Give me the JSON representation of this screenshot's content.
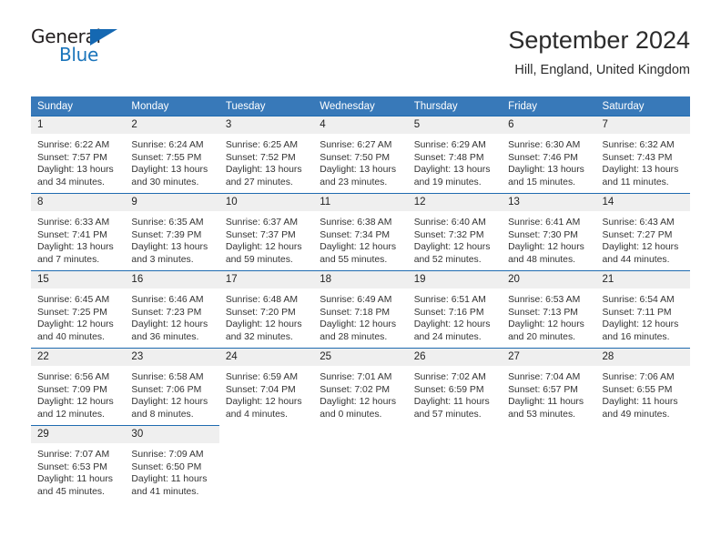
{
  "brand": {
    "name_part1": "General",
    "name_part2": "Blue",
    "triangle_color": "#1568b2",
    "blue_color": "#1b75bb"
  },
  "header": {
    "title": "September 2024",
    "subtitle": "Hill, England, United Kingdom"
  },
  "theme": {
    "header_row_bg": "#3879b9",
    "row_top_border": "#1f6bb0",
    "daynum_bg": "#efefef"
  },
  "weekday_headers": [
    "Sunday",
    "Monday",
    "Tuesday",
    "Wednesday",
    "Thursday",
    "Friday",
    "Saturday"
  ],
  "weeks": [
    [
      {
        "day": "1",
        "sunrise": "Sunrise: 6:22 AM",
        "sunset": "Sunset: 7:57 PM",
        "daylight1": "Daylight: 13 hours",
        "daylight2": "and 34 minutes."
      },
      {
        "day": "2",
        "sunrise": "Sunrise: 6:24 AM",
        "sunset": "Sunset: 7:55 PM",
        "daylight1": "Daylight: 13 hours",
        "daylight2": "and 30 minutes."
      },
      {
        "day": "3",
        "sunrise": "Sunrise: 6:25 AM",
        "sunset": "Sunset: 7:52 PM",
        "daylight1": "Daylight: 13 hours",
        "daylight2": "and 27 minutes."
      },
      {
        "day": "4",
        "sunrise": "Sunrise: 6:27 AM",
        "sunset": "Sunset: 7:50 PM",
        "daylight1": "Daylight: 13 hours",
        "daylight2": "and 23 minutes."
      },
      {
        "day": "5",
        "sunrise": "Sunrise: 6:29 AM",
        "sunset": "Sunset: 7:48 PM",
        "daylight1": "Daylight: 13 hours",
        "daylight2": "and 19 minutes."
      },
      {
        "day": "6",
        "sunrise": "Sunrise: 6:30 AM",
        "sunset": "Sunset: 7:46 PM",
        "daylight1": "Daylight: 13 hours",
        "daylight2": "and 15 minutes."
      },
      {
        "day": "7",
        "sunrise": "Sunrise: 6:32 AM",
        "sunset": "Sunset: 7:43 PM",
        "daylight1": "Daylight: 13 hours",
        "daylight2": "and 11 minutes."
      }
    ],
    [
      {
        "day": "8",
        "sunrise": "Sunrise: 6:33 AM",
        "sunset": "Sunset: 7:41 PM",
        "daylight1": "Daylight: 13 hours",
        "daylight2": "and 7 minutes."
      },
      {
        "day": "9",
        "sunrise": "Sunrise: 6:35 AM",
        "sunset": "Sunset: 7:39 PM",
        "daylight1": "Daylight: 13 hours",
        "daylight2": "and 3 minutes."
      },
      {
        "day": "10",
        "sunrise": "Sunrise: 6:37 AM",
        "sunset": "Sunset: 7:37 PM",
        "daylight1": "Daylight: 12 hours",
        "daylight2": "and 59 minutes."
      },
      {
        "day": "11",
        "sunrise": "Sunrise: 6:38 AM",
        "sunset": "Sunset: 7:34 PM",
        "daylight1": "Daylight: 12 hours",
        "daylight2": "and 55 minutes."
      },
      {
        "day": "12",
        "sunrise": "Sunrise: 6:40 AM",
        "sunset": "Sunset: 7:32 PM",
        "daylight1": "Daylight: 12 hours",
        "daylight2": "and 52 minutes."
      },
      {
        "day": "13",
        "sunrise": "Sunrise: 6:41 AM",
        "sunset": "Sunset: 7:30 PM",
        "daylight1": "Daylight: 12 hours",
        "daylight2": "and 48 minutes."
      },
      {
        "day": "14",
        "sunrise": "Sunrise: 6:43 AM",
        "sunset": "Sunset: 7:27 PM",
        "daylight1": "Daylight: 12 hours",
        "daylight2": "and 44 minutes."
      }
    ],
    [
      {
        "day": "15",
        "sunrise": "Sunrise: 6:45 AM",
        "sunset": "Sunset: 7:25 PM",
        "daylight1": "Daylight: 12 hours",
        "daylight2": "and 40 minutes."
      },
      {
        "day": "16",
        "sunrise": "Sunrise: 6:46 AM",
        "sunset": "Sunset: 7:23 PM",
        "daylight1": "Daylight: 12 hours",
        "daylight2": "and 36 minutes."
      },
      {
        "day": "17",
        "sunrise": "Sunrise: 6:48 AM",
        "sunset": "Sunset: 7:20 PM",
        "daylight1": "Daylight: 12 hours",
        "daylight2": "and 32 minutes."
      },
      {
        "day": "18",
        "sunrise": "Sunrise: 6:49 AM",
        "sunset": "Sunset: 7:18 PM",
        "daylight1": "Daylight: 12 hours",
        "daylight2": "and 28 minutes."
      },
      {
        "day": "19",
        "sunrise": "Sunrise: 6:51 AM",
        "sunset": "Sunset: 7:16 PM",
        "daylight1": "Daylight: 12 hours",
        "daylight2": "and 24 minutes."
      },
      {
        "day": "20",
        "sunrise": "Sunrise: 6:53 AM",
        "sunset": "Sunset: 7:13 PM",
        "daylight1": "Daylight: 12 hours",
        "daylight2": "and 20 minutes."
      },
      {
        "day": "21",
        "sunrise": "Sunrise: 6:54 AM",
        "sunset": "Sunset: 7:11 PM",
        "daylight1": "Daylight: 12 hours",
        "daylight2": "and 16 minutes."
      }
    ],
    [
      {
        "day": "22",
        "sunrise": "Sunrise: 6:56 AM",
        "sunset": "Sunset: 7:09 PM",
        "daylight1": "Daylight: 12 hours",
        "daylight2": "and 12 minutes."
      },
      {
        "day": "23",
        "sunrise": "Sunrise: 6:58 AM",
        "sunset": "Sunset: 7:06 PM",
        "daylight1": "Daylight: 12 hours",
        "daylight2": "and 8 minutes."
      },
      {
        "day": "24",
        "sunrise": "Sunrise: 6:59 AM",
        "sunset": "Sunset: 7:04 PM",
        "daylight1": "Daylight: 12 hours",
        "daylight2": "and 4 minutes."
      },
      {
        "day": "25",
        "sunrise": "Sunrise: 7:01 AM",
        "sunset": "Sunset: 7:02 PM",
        "daylight1": "Daylight: 12 hours",
        "daylight2": "and 0 minutes."
      },
      {
        "day": "26",
        "sunrise": "Sunrise: 7:02 AM",
        "sunset": "Sunset: 6:59 PM",
        "daylight1": "Daylight: 11 hours",
        "daylight2": "and 57 minutes."
      },
      {
        "day": "27",
        "sunrise": "Sunrise: 7:04 AM",
        "sunset": "Sunset: 6:57 PM",
        "daylight1": "Daylight: 11 hours",
        "daylight2": "and 53 minutes."
      },
      {
        "day": "28",
        "sunrise": "Sunrise: 7:06 AM",
        "sunset": "Sunset: 6:55 PM",
        "daylight1": "Daylight: 11 hours",
        "daylight2": "and 49 minutes."
      }
    ],
    [
      {
        "day": "29",
        "sunrise": "Sunrise: 7:07 AM",
        "sunset": "Sunset: 6:53 PM",
        "daylight1": "Daylight: 11 hours",
        "daylight2": "and 45 minutes."
      },
      {
        "day": "30",
        "sunrise": "Sunrise: 7:09 AM",
        "sunset": "Sunset: 6:50 PM",
        "daylight1": "Daylight: 11 hours",
        "daylight2": "and 41 minutes."
      },
      {
        "day": "",
        "sunrise": "",
        "sunset": "",
        "daylight1": "",
        "daylight2": ""
      },
      {
        "day": "",
        "sunrise": "",
        "sunset": "",
        "daylight1": "",
        "daylight2": ""
      },
      {
        "day": "",
        "sunrise": "",
        "sunset": "",
        "daylight1": "",
        "daylight2": ""
      },
      {
        "day": "",
        "sunrise": "",
        "sunset": "",
        "daylight1": "",
        "daylight2": ""
      },
      {
        "day": "",
        "sunrise": "",
        "sunset": "",
        "daylight1": "",
        "daylight2": ""
      }
    ]
  ]
}
